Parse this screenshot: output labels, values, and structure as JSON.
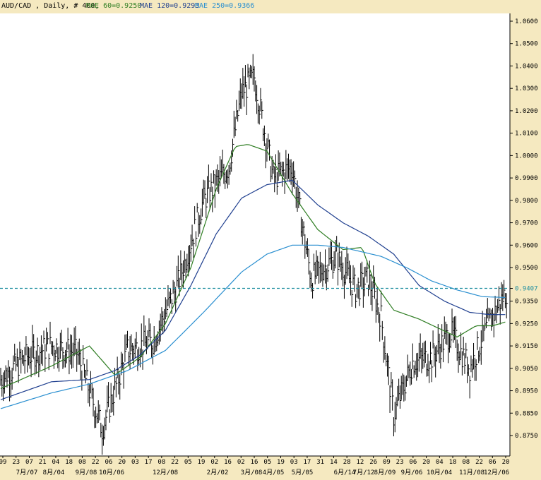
{
  "header": {
    "symbol": "AUD/CAD , Daily, # 400,",
    "ma60": "MAE 60=0.9250",
    "ma120": "MAE 120=0.9293",
    "ma250": "MAE 250=0.9366"
  },
  "colors": {
    "background": "#f5e9c0",
    "plot_bg": "#ffffff",
    "price": "#000000",
    "ma60": "#2e7d22",
    "ma120": "#1f3f8f",
    "ma250": "#2a8fd0",
    "current_line": "#1f8fa0"
  },
  "chart_data": {
    "type": "line",
    "title": "AUD/CAD , Daily, # 400,",
    "ylim": [
      0.87,
      1.065
    ],
    "y_ticks": [
      "1.0600",
      "1.0500",
      "1.0400",
      "1.0300",
      "1.0200",
      "1.0100",
      "1.0000",
      "0.9900",
      "0.9800",
      "0.9700",
      "0.9600",
      "0.9500",
      "0.9407",
      "0.9350",
      "0.9250",
      "0.9150",
      "0.9050",
      "0.8950",
      "0.8850",
      "0.8750"
    ],
    "current_price": 0.9407,
    "current_label": "0.9407",
    "x_day_labels": [
      "09",
      "23",
      "07",
      "21",
      "04",
      "18",
      "08",
      "22",
      "06",
      "20",
      "03",
      "17",
      "08",
      "22",
      "05",
      "19",
      "02",
      "16",
      "02",
      "16",
      "05",
      "19",
      "03",
      "17",
      "31",
      "14",
      "28",
      "12",
      "26",
      "09",
      "23",
      "06",
      "20",
      "04",
      "18",
      "08",
      "22",
      "06",
      "20"
    ],
    "x_month_labels": [
      "7月/07",
      "8月/04",
      "9月/08",
      "10月/06",
      "12月/08",
      "2月/02",
      "3月/08",
      "4月/05",
      "5月/05",
      "6月/14",
      "7月/12",
      "8月/09",
      "9月/06",
      "10月/04",
      "11月/08",
      "12月/06"
    ],
    "bars": 400,
    "series": [
      {
        "name": "Price",
        "x": [
          0,
          20,
          40,
          60,
          80,
          100,
          120,
          140,
          160,
          180,
          190,
          200,
          215,
          230,
          245,
          255,
          265,
          280,
          290,
          300,
          310,
          325,
          340,
          355,
          370,
          385,
          400
        ],
        "values": [
          0.9,
          0.91,
          0.915,
          0.912,
          0.878,
          0.913,
          0.917,
          0.943,
          0.98,
          0.995,
          1.028,
          1.035,
          0.99,
          0.995,
          0.945,
          0.95,
          0.955,
          0.94,
          0.945,
          0.928,
          0.884,
          0.908,
          0.91,
          0.921,
          0.905,
          0.925,
          0.9407
        ]
      },
      {
        "name": "MAE 60",
        "x": [
          0,
          40,
          70,
          90,
          110,
          130,
          150,
          170,
          185,
          195,
          210,
          230,
          250,
          270,
          285,
          295,
          310,
          330,
          345,
          360,
          375,
          388,
          400
        ],
        "values": [
          0.896,
          0.906,
          0.915,
          0.902,
          0.91,
          0.925,
          0.95,
          0.985,
          1.004,
          1.005,
          1.002,
          0.983,
          0.967,
          0.958,
          0.959,
          0.943,
          0.931,
          0.927,
          0.923,
          0.919,
          0.924,
          0.924,
          0.926
        ]
      },
      {
        "name": "MAE 120",
        "x": [
          0,
          40,
          70,
          90,
          110,
          130,
          150,
          170,
          190,
          210,
          230,
          250,
          270,
          290,
          310,
          330,
          350,
          370,
          385,
          400
        ],
        "values": [
          0.891,
          0.899,
          0.9,
          0.904,
          0.911,
          0.922,
          0.942,
          0.965,
          0.981,
          0.987,
          0.989,
          0.978,
          0.97,
          0.964,
          0.956,
          0.942,
          0.935,
          0.93,
          0.929,
          0.929
        ]
      },
      {
        "name": "MAE 250",
        "x": [
          0,
          40,
          70,
          100,
          130,
          160,
          190,
          210,
          230,
          250,
          270,
          300,
          320,
          340,
          360,
          380,
          400
        ],
        "values": [
          0.887,
          0.894,
          0.898,
          0.904,
          0.913,
          0.93,
          0.948,
          0.956,
          0.96,
          0.96,
          0.959,
          0.955,
          0.95,
          0.944,
          0.94,
          0.937,
          0.9366
        ]
      }
    ]
  }
}
